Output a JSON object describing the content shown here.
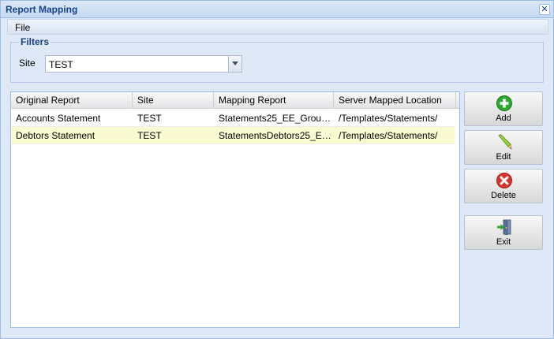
{
  "window": {
    "title": "Report Mapping"
  },
  "menu": {
    "file": "File"
  },
  "filters": {
    "legend": "Filters",
    "site_label": "Site",
    "site_value": "TEST"
  },
  "grid": {
    "columns": [
      "Original Report",
      "Site",
      "Mapping Report",
      "Server Mapped Location"
    ],
    "rows": [
      {
        "original": "Accounts Statement",
        "site": "TEST",
        "mapping": "Statements25_EE_Group...",
        "location": "/Templates/Statements/"
      },
      {
        "original": "Debtors Statement",
        "site": "TEST",
        "mapping": "StatementsDebtors25_EE...",
        "location": "/Templates/Statements/"
      }
    ]
  },
  "buttons": {
    "add": "Add",
    "edit": "Edit",
    "delete": "Delete",
    "exit": "Exit"
  },
  "colors": {
    "accent": "#15428b",
    "selected_row": "#fafad2",
    "add_icon": "#2ea82e",
    "delete_icon": "#d9342b"
  }
}
